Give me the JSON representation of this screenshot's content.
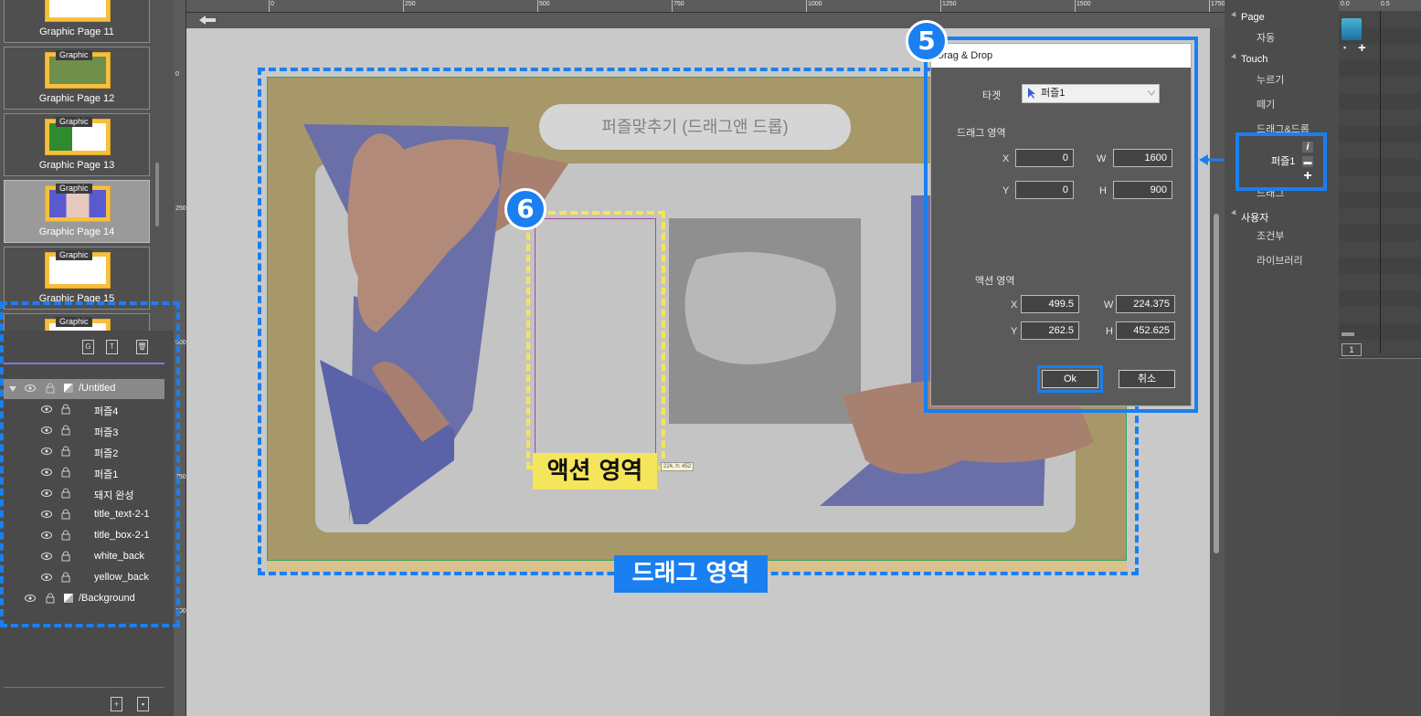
{
  "pages": [
    {
      "label": "Graphic Page 11",
      "tag": "Graphic"
    },
    {
      "label": "Graphic Page 12",
      "tag": "Graphic"
    },
    {
      "label": "Graphic Page 13",
      "tag": "Graphic"
    },
    {
      "label": "Graphic Page 14",
      "tag": "Graphic",
      "selected": true
    },
    {
      "label": "Graphic Page 15",
      "tag": "Graphic"
    },
    {
      "label": "",
      "tag": "Graphic"
    }
  ],
  "layers": {
    "tools": [
      "G",
      "T",
      "🗑"
    ],
    "root": "/Untitled",
    "children": [
      "퍼즐4",
      "퍼즐3",
      "퍼즐2",
      "퍼즐1",
      "돼지 완성",
      "title_text-2-1",
      "title_box-2-1",
      "white_back",
      "yellow_back"
    ],
    "background": "/Background"
  },
  "ruler": {
    "h_labels": [
      "0",
      "250",
      "500",
      "750",
      "1000",
      "1250",
      "1500",
      "1750"
    ],
    "v_labels": [
      "0",
      "250",
      "500",
      "750",
      "1000"
    ]
  },
  "canvas": {
    "title_text": "퍼즐맞추기 (드래그앤 드롭)",
    "size_tooltip": "224, h: 452"
  },
  "annotations": {
    "badge_5": "5",
    "badge_6": "6",
    "action_area_label": "액션 영역",
    "drag_area_label": "드래그 영역"
  },
  "dialog": {
    "title": "Drag & Drop",
    "target_label": "타겟",
    "target_value": "퍼즐1",
    "drag_area_label": "드래그 영역",
    "drag": {
      "x_label": "X",
      "x": "0",
      "w_label": "W",
      "w": "1600",
      "y_label": "Y",
      "y": "0",
      "h_label": "H",
      "h": "900"
    },
    "action_area_label": "액션 영역",
    "action": {
      "x_label": "X",
      "x": "499.5",
      "w_label": "W",
      "w": "224.375",
      "y_label": "Y",
      "y": "262.5",
      "h_label": "H",
      "h": "452.625"
    },
    "ok": "Ok",
    "cancel": "취소"
  },
  "properties": {
    "page_head": "Page",
    "page_items": [
      "자동"
    ],
    "touch_head": "Touch",
    "touch_items": [
      "누르기",
      "떼기",
      "드래그&드롭"
    ],
    "puzzle_item": "퍼즐1",
    "drag_item": "드래그",
    "user_head": "사용자",
    "user_items": [
      "조건부",
      "라이브러리"
    ]
  },
  "timeline": {
    "ruler_labels": [
      "0.0",
      "0.5"
    ],
    "frame": "1"
  },
  "colors": {
    "accent_blue": "#1a7ff0",
    "highlight_yellow": "#f5e55a",
    "stage_olive": "#a7986a"
  }
}
